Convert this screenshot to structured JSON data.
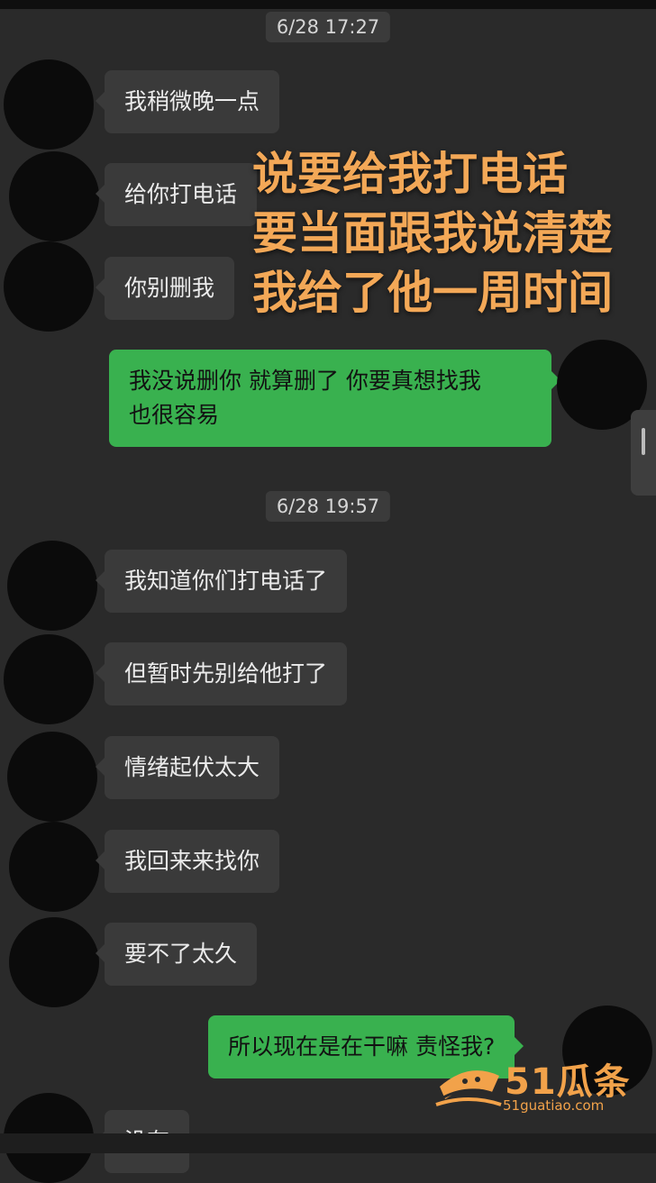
{
  "timestamps": [
    "6/28 17:27",
    "6/28 19:57"
  ],
  "messages": [
    {
      "text": "我稍微晚一点",
      "side": "in"
    },
    {
      "text": "给你打电话",
      "side": "in"
    },
    {
      "text": "你别删我",
      "side": "in"
    },
    {
      "text": "我没说删你 就算删了 你要真想找我\n也很容易",
      "side": "out"
    },
    {
      "text": "我知道你们打电话了",
      "side": "in"
    },
    {
      "text": "但暂时先别给他打了",
      "side": "in"
    },
    {
      "text": "情绪起伏太大",
      "side": "in"
    },
    {
      "text": "我回来来找你",
      "side": "in"
    },
    {
      "text": "要不了太久",
      "side": "in"
    },
    {
      "text": "所以现在是在干嘛 责怪我?",
      "side": "out"
    },
    {
      "text": "没有",
      "side": "in"
    }
  ],
  "overlay": {
    "lines": [
      "说要给我打电话",
      "要当面跟我说清楚",
      "我给了他一周时间"
    ],
    "color": "#f3a857"
  },
  "watermark": {
    "brand": "51瓜条",
    "url": "51guatiao.com",
    "color": "#f2a24a"
  },
  "colors": {
    "background": "#2a2a2a",
    "incoming_bubble": "#3a3a3a",
    "outgoing_bubble": "#39b14f",
    "avatar": "#0b0b0b"
  }
}
